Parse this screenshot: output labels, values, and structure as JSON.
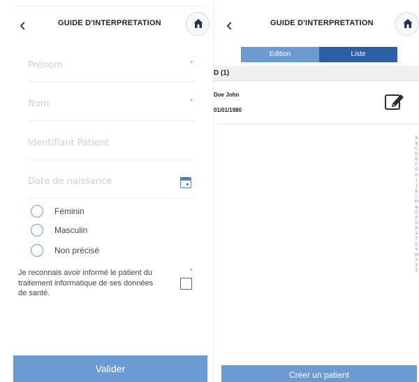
{
  "left_screen": {
    "header": {
      "title": "GUIDE D'INTERPRETATION",
      "back_icon": "chevron-left-icon",
      "home_icon": "home-icon"
    },
    "fields": [
      {
        "name": "prenom",
        "placeholder": "Prénom",
        "required_mark": "*"
      },
      {
        "name": "nom",
        "placeholder": "Nom",
        "required_mark": "*"
      },
      {
        "name": "identifiant",
        "placeholder": "Identifiant Patient",
        "required_mark": ""
      },
      {
        "name": "date-naissance",
        "placeholder": "Date de naissance",
        "required_mark": ""
      }
    ],
    "gender_options": [
      "Féminin",
      "Masculin",
      "Non précisé"
    ],
    "consent": {
      "text": "Je reconnais avoir informé le patient du traitement informatique de ses données de santé.",
      "required_mark": "*"
    },
    "submit_label": "Valider"
  },
  "right_screen": {
    "header": {
      "title": "GUIDE D'INTERPRETATION",
      "back_icon": "chevron-left-icon",
      "home_icon": "home-icon"
    },
    "tabs": [
      {
        "label": "Edition",
        "active": false
      },
      {
        "label": "Liste",
        "active": true
      }
    ],
    "section": "D (1)",
    "patients": [
      {
        "name": "Doe John",
        "dob": "01/01/1980"
      }
    ],
    "alphabet": [
      "A",
      "B",
      "C",
      "D",
      "E",
      "F",
      "G",
      "H",
      "I",
      "J",
      "K",
      "L",
      "M",
      "N",
      "O",
      "P",
      "Q",
      "R",
      "S",
      "T",
      "U",
      "V",
      "W",
      "X",
      "Y",
      "Z"
    ],
    "create_label": "Créer un patient"
  },
  "colors": {
    "accent": "#6c9ad3",
    "tab_active": "#2d5fa8",
    "required": "#e05656",
    "placeholder": "#cfcfcf"
  }
}
